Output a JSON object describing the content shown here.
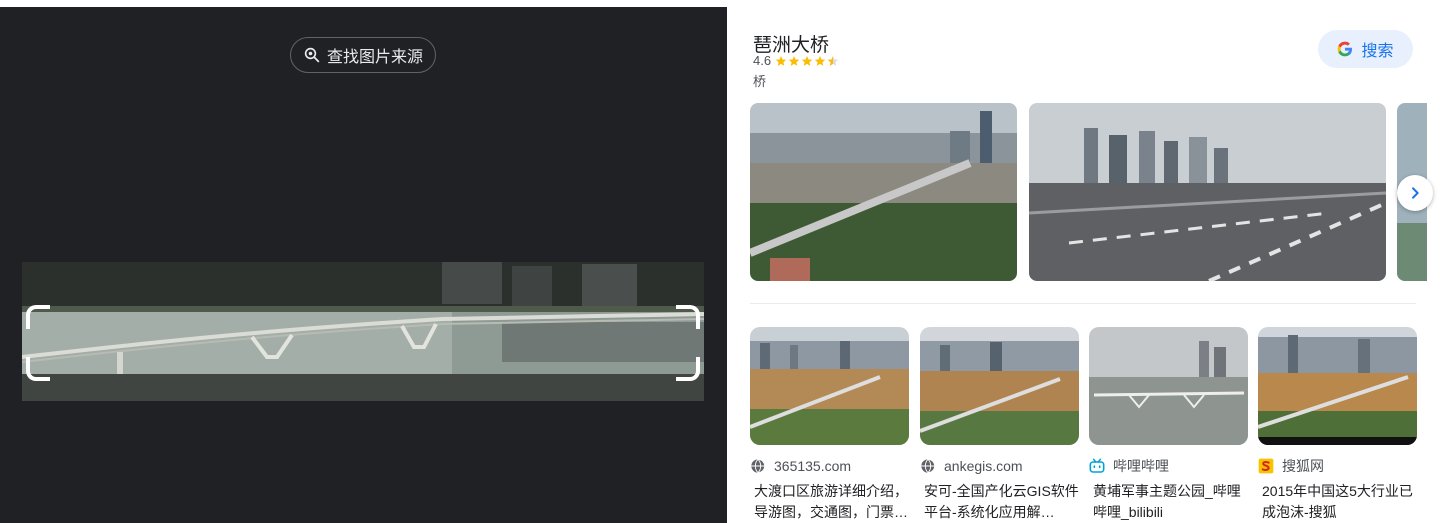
{
  "left": {
    "find_source_label": "查找图片来源"
  },
  "knowledge": {
    "title": "琶洲大桥",
    "rating": "4.6",
    "stars": 4.5,
    "category": "桥"
  },
  "search_button_label": "搜索",
  "results": [
    {
      "source": "365135.com",
      "title": "大渡口区旅游详细介绍，导游图，交通图，门票…",
      "icon": "globe-icon"
    },
    {
      "source": "ankegis.com",
      "title": "安可-全国产化云GIS软件平台-系统化应用解…",
      "icon": "globe-icon"
    },
    {
      "source": "哔哩哔哩",
      "title": "黄埔军事主题公园_哔哩哔哩_bilibili",
      "icon": "bilibili-icon"
    },
    {
      "source": "搜狐网",
      "title": "2015年中国这5大行业已成泡沫-搜狐",
      "icon": "sohu-icon"
    }
  ],
  "colors": {
    "left_bg": "#202124",
    "accent": "#1a73e8",
    "star": "#fbbc04"
  }
}
